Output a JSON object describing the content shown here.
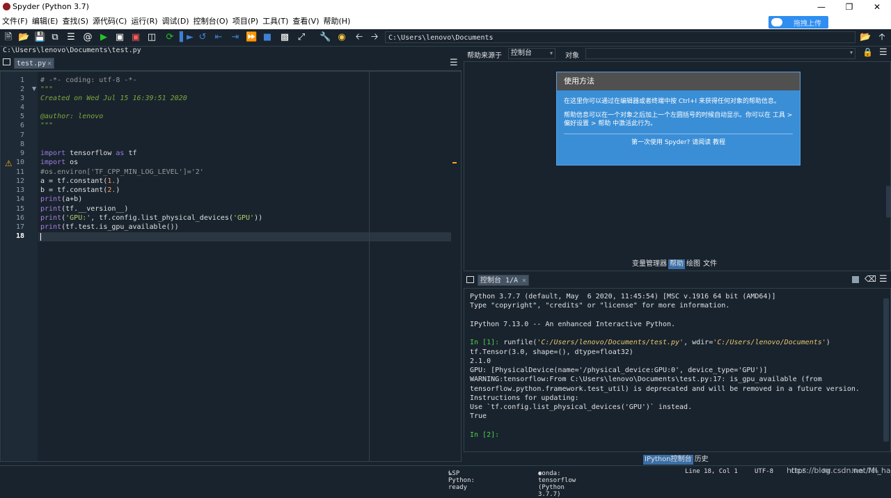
{
  "window": {
    "title": "Spyder (Python 3.7)"
  },
  "menu": [
    "文件(F)",
    "编辑(E)",
    "查找(S)",
    "源代码(C)",
    "运行(R)",
    "调试(D)",
    "控制台(O)",
    "项目(P)",
    "工具(T)",
    "查看(V)",
    "帮助(H)"
  ],
  "upload_button": "拖拽上传",
  "toolbar": {
    "path": "C:\\Users\\lenovo\\Documents"
  },
  "editor": {
    "file_path": "C:\\Users\\lenovo\\Documents\\test.py",
    "tab": "test.py",
    "line_numbers": [
      "1",
      "2",
      "3",
      "4",
      "5",
      "6",
      "7",
      "8",
      "9",
      "10",
      "11",
      "12",
      "13",
      "14",
      "15",
      "16",
      "17",
      "18"
    ],
    "lines": [
      "# -*- coding: utf-8 -*-",
      "\"\"\"",
      "Created on Wed Jul 15 16:39:51 2020",
      "",
      "@author: lenovo",
      "\"\"\"",
      "",
      "",
      "import tensorflow as tf",
      "import os",
      "#os.environ['TF_CPP_MIN_LOG_LEVEL']='2'",
      "a = tf.constant(1.)",
      "b = tf.constant(2.)",
      "print(a+b)",
      "print(tf.__version__)",
      "print('GPU:', tf.config.list_physical_devices('GPU'))",
      "print(tf.test.is_gpu_available())",
      ""
    ]
  },
  "help": {
    "source_label": "帮助来源于",
    "source_value": "控制台",
    "object_label": "对象",
    "tip_title": "使用方法",
    "tip_p1": "在这里你可以通过在编辑器或者终端中按 Ctrl+I 来获得任何对象的帮助信息。",
    "tip_p2": "帮助信息可以在一个对象之后加上一个左圆括号的时候自动显示。你可以在 工具 > 偏好设置 > 帮助 中激活此行为。",
    "tip_footer": "第一次使用 Spyder? 请阅读 教程",
    "tabs": [
      "变量管理器",
      "帮助",
      "绘图",
      "文件"
    ]
  },
  "console": {
    "tab": "控制台 1/A",
    "lines": [
      "Python 3.7.7 (default, May  6 2020, 11:45:54) [MSC v.1916 64 bit (AMD64)]",
      "Type \"copyright\", \"credits\" or \"license\" for more information.",
      "",
      "IPython 7.13.0 -- An enhanced Interactive Python.",
      "",
      "",
      "tf.Tensor(3.0, shape=(), dtype=float32)",
      "2.1.0",
      "GPU: [PhysicalDevice(name='/physical_device:GPU:0', device_type='GPU')]",
      "WARNING:tensorflow:From C:\\Users\\lenovo\\Documents\\test.py:17: is_gpu_available (from",
      "tensorflow.python.framework.test_util) is deprecated and will be removed in a future version.",
      "Instructions for updating:",
      "Use `tf.config.list_physical_devices('GPU')` instead.",
      "True"
    ],
    "in1_prompt": "In [1]:",
    "in1_cmd": "runfile('C:/Users/lenovo/Documents/test.py', wdir='C:/Users/lenovo/Documents')",
    "in2_prompt": "In [2]:",
    "tabs": [
      "IPython控制台",
      "历史"
    ]
  },
  "status": {
    "lsp": "LSP Python: ready",
    "conda": "conda: tensorflow (Python 3.7.7)",
    "position": "Line 18, Col 1",
    "encoding": "UTF-8",
    "eol": "CRLF",
    "perm": "RW",
    "mem": "Mem 71%",
    "watermark": "https://blog.csdn.net/MI_ha_M"
  }
}
